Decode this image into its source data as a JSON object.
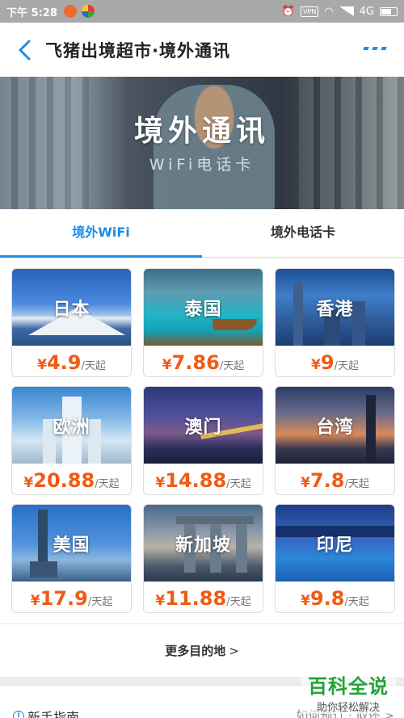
{
  "status_bar": {
    "time": "下午 5:28",
    "vpn": "VPN",
    "network": "4G"
  },
  "header": {
    "title": "飞猪出境超市·境外通讯"
  },
  "banner": {
    "title": "境外通讯",
    "subtitle": "WiFi电话卡"
  },
  "tabs": [
    {
      "label": "境外WiFi",
      "active": true
    },
    {
      "label": "境外电话卡",
      "active": false
    }
  ],
  "destinations": [
    {
      "name": "日本",
      "yen": "¥",
      "price": "4.9",
      "unit": "/天起"
    },
    {
      "name": "泰国",
      "yen": "¥",
      "price": "7.86",
      "unit": "/天起"
    },
    {
      "name": "香港",
      "yen": "¥",
      "price": "9",
      "unit": "/天起"
    },
    {
      "name": "欧洲",
      "yen": "¥",
      "price": "20.88",
      "unit": "/天起"
    },
    {
      "name": "澳门",
      "yen": "¥",
      "price": "14.88",
      "unit": "/天起"
    },
    {
      "name": "台湾",
      "yen": "¥",
      "price": "7.8",
      "unit": "/天起"
    },
    {
      "name": "美国",
      "yen": "¥",
      "price": "17.9",
      "unit": "/天起"
    },
    {
      "name": "新加坡",
      "yen": "¥",
      "price": "11.88",
      "unit": "/天起"
    },
    {
      "name": "印尼",
      "yen": "¥",
      "price": "9.8",
      "unit": "/天起"
    }
  ],
  "more_destinations": {
    "label": "更多目的地",
    "chevron": ">"
  },
  "guide": {
    "title": "新手指南",
    "links": "如何预订 · 取还 >"
  },
  "watermark": {
    "main": "百科全说",
    "sub": "助你轻松解决"
  },
  "colors": {
    "accent": "#1c8de8",
    "price": "#f05a14",
    "watermark": "#23a33a"
  }
}
